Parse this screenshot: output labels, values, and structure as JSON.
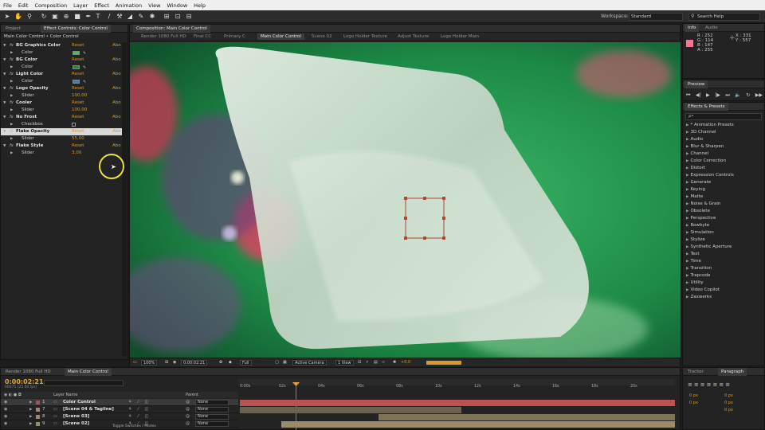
{
  "menu": [
    "File",
    "Edit",
    "Composition",
    "Layer",
    "Effect",
    "Animation",
    "View",
    "Window",
    "Help"
  ],
  "toolbar": {
    "workspace_label": "Workspace:",
    "workspace_value": "Standard",
    "search_placeholder": "Search Help"
  },
  "left_panel": {
    "tabs": [
      "Project",
      "Effect Controls: Color Control"
    ],
    "subtitle": "Main Color Control • Color Control",
    "reset_label": "Reset",
    "about_label": "Abo",
    "effects": [
      {
        "name": "BG Graphics Color",
        "prop": "Color",
        "kind": "color",
        "color": "#2fd12f"
      },
      {
        "name": "BG Color",
        "prop": "Color",
        "kind": "color",
        "color": "#1f8f24"
      },
      {
        "name": "Light Color",
        "prop": "Color",
        "kind": "color",
        "color": "#3a7bd5"
      },
      {
        "name": "Logo  Opacity",
        "prop": "Slider",
        "kind": "slider",
        "value": "100,00"
      },
      {
        "name": "Cooler",
        "prop": "Slider",
        "kind": "slider",
        "value": "100,00"
      },
      {
        "name": "No Frost",
        "prop": "Checkbox",
        "kind": "checkbox"
      },
      {
        "name": "Flake Opacity",
        "prop": "Slider",
        "kind": "slider",
        "value": "55,00",
        "selected": true
      },
      {
        "name": "Flake Style",
        "prop": "Slider",
        "kind": "slider",
        "value": "3,00"
      }
    ]
  },
  "composition": {
    "tab": "Composition: Main Color Control",
    "crumbs": [
      "Render 1080 Full HD",
      "Final CC",
      "Primary C",
      "Main Color Control",
      "Scene 02",
      "Logo Holder Texture",
      "Adjust Texture",
      "Logo Holder Main"
    ],
    "active_crumb": "Main Color Control",
    "zoom": "100%",
    "timecode": "0:00:02:21",
    "resolution": "Full",
    "camera": "Active Camera",
    "view": "1 View",
    "exposure": "+0,0"
  },
  "info": {
    "tabs": [
      "Info",
      "Audio"
    ],
    "r": "R : 252",
    "g": "G : 114",
    "b": "B : 147",
    "a": "A : 255",
    "x": "X : 331",
    "y": "Y : 557",
    "swatch_color": "#fc7293"
  },
  "preview": {
    "tab": "Preview"
  },
  "effects_presets": {
    "tab": "Effects & Presets",
    "search_placeholder": "ρ•",
    "items": [
      "* Animation Presets",
      "3D Channel",
      "Audio",
      "Blur & Sharpen",
      "Channel",
      "Color Correction",
      "Distort",
      "Expression Controls",
      "Generate",
      "Keying",
      "Matte",
      "Noise & Grain",
      "Obsolete",
      "Perspective",
      "Rowbyte",
      "Simulation",
      "Stylize",
      "Synthetic Aperture",
      "Text",
      "Time",
      "Transition",
      "Trapcode",
      "Utility",
      "Video Copilot",
      "Zaxwerks"
    ]
  },
  "timeline": {
    "tabs": [
      "Render 1080 Full HD",
      "Main Color Control"
    ],
    "time": "0:00:02:21",
    "frames": "00071 (25.00 fps)",
    "col_layer_name": "Layer Name",
    "col_parent": "Parent",
    "ruler": [
      "0:00s",
      "02s",
      "04s",
      "06s",
      "08s",
      "10s",
      "12s",
      "14s",
      "16s",
      "18s",
      "20s"
    ],
    "layers": [
      {
        "num": "1",
        "name": "Color Control",
        "parent": "None",
        "label": "#b84b4b"
      },
      {
        "num": "7",
        "name": "[Scene 04 & Tagline]",
        "parent": "None",
        "label": "#9a8a6a"
      },
      {
        "num": "8",
        "name": "[Scene 03]",
        "parent": "None",
        "label": "#9a8a6a"
      },
      {
        "num": "9",
        "name": "[Scene 02]",
        "parent": "None",
        "label": "#9a8a6a"
      }
    ],
    "footer": "Toggle Switches / Modes"
  },
  "right_bottom": {
    "tabs": [
      "Tracker",
      "Paragraph"
    ],
    "px_values": [
      "0 px",
      "0 px",
      "0 px",
      "0 px",
      "0 px"
    ]
  }
}
